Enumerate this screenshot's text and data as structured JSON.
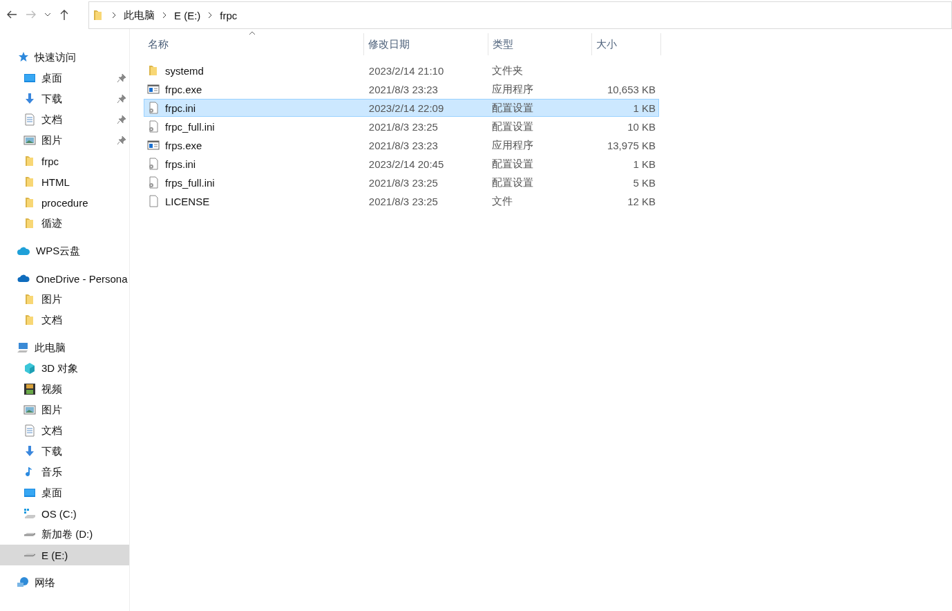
{
  "address_bar": {
    "path": [
      "此电脑",
      "E (E:)",
      "frpc"
    ]
  },
  "sidebar": {
    "groups": [
      {
        "label": "快速访问",
        "kind": "star",
        "selected": false,
        "children": [
          {
            "label": "桌面",
            "kind": "desktop",
            "pinned": true,
            "selected": false
          },
          {
            "label": "下载",
            "kind": "download",
            "pinned": true,
            "selected": false
          },
          {
            "label": "文档",
            "kind": "document",
            "pinned": true,
            "selected": false
          },
          {
            "label": "图片",
            "kind": "picture",
            "pinned": true,
            "selected": false
          },
          {
            "label": "frpc",
            "kind": "folder",
            "pinned": false,
            "selected": false
          },
          {
            "label": "HTML",
            "kind": "folder",
            "pinned": false,
            "selected": false
          },
          {
            "label": "procedure",
            "kind": "folder",
            "pinned": false,
            "selected": false
          },
          {
            "label": "循迹",
            "kind": "folder",
            "pinned": false,
            "selected": false
          }
        ]
      },
      {
        "label": "WPS云盘",
        "kind": "cloud-wps",
        "selected": false
      },
      {
        "label": "OneDrive - Persona",
        "kind": "onedrive",
        "selected": false,
        "children": [
          {
            "label": "图片",
            "kind": "folder",
            "pinned": false,
            "selected": false
          },
          {
            "label": "文档",
            "kind": "folder",
            "pinned": false,
            "selected": false
          }
        ]
      },
      {
        "label": "此电脑",
        "kind": "pc",
        "selected": false,
        "children": [
          {
            "label": "3D 对象",
            "kind": "cube",
            "pinned": false,
            "selected": false
          },
          {
            "label": "视频",
            "kind": "video",
            "pinned": false,
            "selected": false
          },
          {
            "label": "图片",
            "kind": "picture",
            "pinned": false,
            "selected": false
          },
          {
            "label": "文档",
            "kind": "document",
            "pinned": false,
            "selected": false
          },
          {
            "label": "下载",
            "kind": "download",
            "pinned": false,
            "selected": false
          },
          {
            "label": "音乐",
            "kind": "music",
            "pinned": false,
            "selected": false
          },
          {
            "label": "桌面",
            "kind": "desktop",
            "pinned": false,
            "selected": false
          },
          {
            "label": "OS (C:)",
            "kind": "drive-os",
            "pinned": false,
            "selected": false
          },
          {
            "label": "新加卷 (D:)",
            "kind": "drive",
            "pinned": false,
            "selected": false
          },
          {
            "label": "E (E:)",
            "kind": "drive",
            "pinned": false,
            "selected": true
          }
        ]
      },
      {
        "label": "网络",
        "kind": "network",
        "selected": false
      }
    ]
  },
  "file_list": {
    "columns": [
      "名称",
      "修改日期",
      "类型",
      "大小"
    ],
    "rows": [
      {
        "name": "systemd",
        "kind": "folder",
        "modified": "2023/2/14 21:10",
        "type": "文件夹",
        "selected": false
      },
      {
        "name": "frpc.exe",
        "kind": "exe",
        "modified": "2021/8/3 23:23",
        "type": "应用程序",
        "size": "10,653 KB",
        "selected": false
      },
      {
        "name": "frpc.ini",
        "kind": "ini",
        "modified": "2023/2/14 22:09",
        "type": "配置设置",
        "size": "1 KB",
        "selected": true
      },
      {
        "name": "frpc_full.ini",
        "kind": "ini",
        "modified": "2021/8/3 23:25",
        "type": "配置设置",
        "size": "10 KB",
        "selected": false
      },
      {
        "name": "frps.exe",
        "kind": "exe",
        "modified": "2021/8/3 23:23",
        "type": "应用程序",
        "size": "13,975 KB",
        "selected": false
      },
      {
        "name": "frps.ini",
        "kind": "ini",
        "modified": "2023/2/14 20:45",
        "type": "配置设置",
        "size": "1 KB",
        "selected": false
      },
      {
        "name": "frps_full.ini",
        "kind": "ini",
        "modified": "2021/8/3 23:25",
        "type": "配置设置",
        "size": "5 KB",
        "selected": false
      },
      {
        "name": "LICENSE",
        "kind": "file",
        "modified": "2021/8/3 23:25",
        "type": "文件",
        "size": "12 KB",
        "selected": false
      }
    ]
  }
}
